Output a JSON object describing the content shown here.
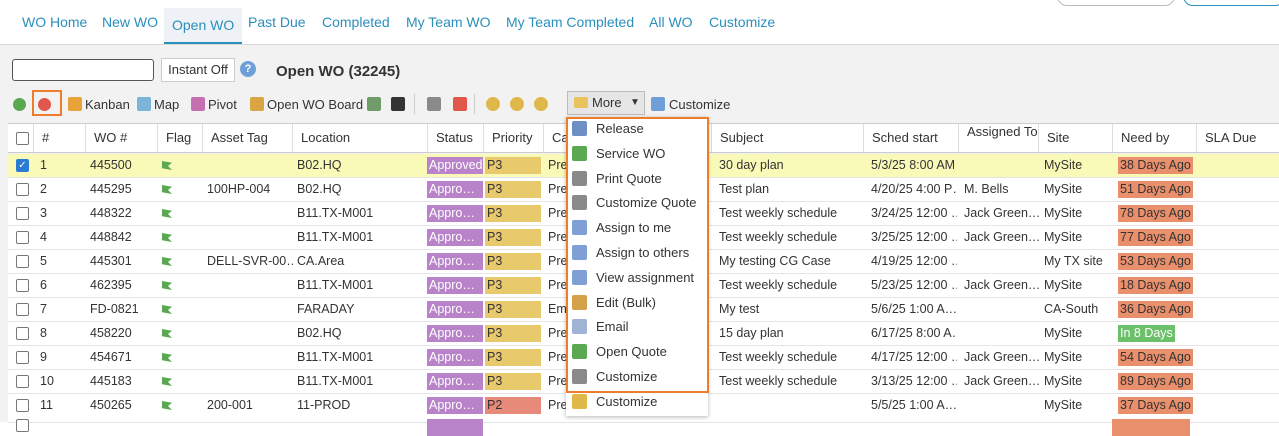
{
  "tabs": [
    {
      "label": "WO Home"
    },
    {
      "label": "New WO"
    },
    {
      "label": "Open WO"
    },
    {
      "label": "Past Due"
    },
    {
      "label": "Completed"
    },
    {
      "label": "My Team WO"
    },
    {
      "label": "My Team Completed"
    },
    {
      "label": "All WO"
    },
    {
      "label": "Customize"
    }
  ],
  "active_tab": "Open WO",
  "toolbar": {
    "search_value": "",
    "instant_label": "Instant Off",
    "page_title": "Open WO (32245)",
    "kanban": "Kanban",
    "map": "Map",
    "pivot": "Pivot",
    "open_board": "Open WO Board",
    "more": "More",
    "customize": "Customize"
  },
  "table": {
    "headers": [
      "#",
      "WO #",
      "Flag",
      "Asset Tag",
      "Location",
      "Status",
      "Priority",
      "Cat",
      "Subject",
      "Sched start",
      "Assigned To",
      "Site",
      "Need by",
      "SLA Due"
    ],
    "rows": [
      {
        "num": "1",
        "wo": "445500",
        "asset": "",
        "location": "B02.HQ",
        "status": "Approved",
        "priority": "P3",
        "cat": "Prev",
        "subject": "30 day plan",
        "sched": "5/3/25 8:00 AM (",
        "assigned": "",
        "site": "MySite",
        "need": "38 Days Ago",
        "need_color": "#ea8f6c",
        "checked": true,
        "selected": true
      },
      {
        "num": "2",
        "wo": "445295",
        "asset": "100HP-004",
        "location": "B02.HQ",
        "status": "Appro…",
        "priority": "P3",
        "cat": "Prev",
        "subject": "Test plan",
        "sched": "4/20/25 4:00 P…",
        "assigned": "M. Bells",
        "site": "MySite",
        "need": "51 Days Ago",
        "need_color": "#ea8f6c",
        "checked": false,
        "selected": false
      },
      {
        "num": "3",
        "wo": "448322",
        "asset": "",
        "location": "B11.TX-M001",
        "status": "Appro…",
        "priority": "P3",
        "cat": "Prev",
        "subject": "Test weekly schedule",
        "sched": "3/24/25 12:00 …",
        "assigned": "Jack Green…",
        "site": "MySite",
        "need": "78 Days Ago",
        "need_color": "#ea8f6c",
        "checked": false,
        "selected": false
      },
      {
        "num": "4",
        "wo": "448842",
        "asset": "",
        "location": "B11.TX-M001",
        "status": "Appro…",
        "priority": "P3",
        "cat": "Prev",
        "subject": "Test weekly schedule",
        "sched": "3/25/25 12:00 …",
        "assigned": "Jack Green…",
        "site": "MySite",
        "need": "77 Days Ago",
        "need_color": "#ea8f6c",
        "checked": false,
        "selected": false
      },
      {
        "num": "5",
        "wo": "445301",
        "asset": "DELL-SVR-00…",
        "location": "CA.Area",
        "status": "Appro…",
        "priority": "P3",
        "cat": "Prev",
        "subject": "My testing CG Case",
        "sched": "4/19/25 12:00 …",
        "assigned": "",
        "site": "My TX site",
        "need": "53 Days Ago",
        "need_color": "#ea8f6c",
        "checked": false,
        "selected": false
      },
      {
        "num": "6",
        "wo": "462395",
        "asset": "",
        "location": "B11.TX-M001",
        "status": "Appro…",
        "priority": "P3",
        "cat": "Prev",
        "subject": "Test weekly schedule",
        "sched": "5/23/25 12:00 …",
        "assigned": "Jack Green…",
        "site": "MySite",
        "need": "18 Days Ago",
        "need_color": "#ea8f6c",
        "checked": false,
        "selected": false
      },
      {
        "num": "7",
        "wo": "FD-0821",
        "asset": "",
        "location": "FARADAY",
        "status": "Appro…",
        "priority": "P3",
        "cat": "Em",
        "subject": "My test",
        "sched": "5/6/25 1:00 A…",
        "assigned": "",
        "site": "CA-South",
        "need": "36 Days Ago",
        "need_color": "#ea8f6c",
        "checked": false,
        "selected": false
      },
      {
        "num": "8",
        "wo": "458220",
        "asset": "",
        "location": "B02.HQ",
        "status": "Appro…",
        "priority": "P3",
        "cat": "Prev",
        "subject": "15 day plan",
        "sched": "6/17/25 8:00 A…",
        "assigned": "",
        "site": "MySite",
        "need": "In 8 Days",
        "need_color": "#6cc06a",
        "checked": false,
        "selected": false
      },
      {
        "num": "9",
        "wo": "454671",
        "asset": "",
        "location": "B11.TX-M001",
        "status": "Appro…",
        "priority": "P3",
        "cat": "Prev",
        "subject": "Test weekly schedule",
        "sched": "4/17/25 12:00 …",
        "assigned": "Jack Green…",
        "site": "MySite",
        "need": "54 Days Ago",
        "need_color": "#ea8f6c",
        "checked": false,
        "selected": false
      },
      {
        "num": "10",
        "wo": "445183",
        "asset": "",
        "location": "B11.TX-M001",
        "status": "Appro…",
        "priority": "P3",
        "cat": "Prev",
        "subject": "Test weekly schedule",
        "sched": "3/13/25 12:00 …",
        "assigned": "Jack Green…",
        "site": "MySite",
        "need": "89 Days Ago",
        "need_color": "#ea8f6c",
        "checked": false,
        "selected": false
      },
      {
        "num": "11",
        "wo": "450265",
        "asset": "200-001",
        "location": "11-PROD",
        "status": "Appro…",
        "priority": "P2",
        "cat": "Prev",
        "subject": "",
        "sched": "5/5/25 1:00 A…",
        "assigned": "",
        "site": "MySite",
        "need": "37 Days Ago",
        "need_color": "#ea8f6c",
        "checked": false,
        "selected": false
      }
    ]
  },
  "more_menu": [
    {
      "label": "Release",
      "icon": "release-icon",
      "color": "#6d8fc6"
    },
    {
      "label": "Service WO",
      "icon": "service-wo-icon",
      "color": "#5aa84f"
    },
    {
      "label": "Print Quote",
      "icon": "printer-icon",
      "color": "#8a8a8a"
    },
    {
      "label": "Customize Quote",
      "icon": "printer-icon",
      "color": "#8a8a8a"
    },
    {
      "label": "Assign to me",
      "icon": "document-icon",
      "color": "#7fa0d4"
    },
    {
      "label": "Assign to others",
      "icon": "document-icon",
      "color": "#7fa0d4"
    },
    {
      "label": "View assignment",
      "icon": "document-icon",
      "color": "#7fa0d4"
    },
    {
      "label": "Edit (Bulk)",
      "icon": "edit-icon",
      "color": "#d4a14a"
    },
    {
      "label": "Email",
      "icon": "envelope-icon",
      "color": "#9fb3d6"
    },
    {
      "label": "Open Quote",
      "icon": "open-quote-icon",
      "color": "#5aa84f"
    },
    {
      "label": "Customize",
      "icon": "printer-icon",
      "color": "#8a8a8a"
    },
    {
      "label": "Customize",
      "icon": "customize-icon",
      "color": "#e0b84a"
    }
  ],
  "colors": {
    "accent": "#2a8fbd",
    "highlight": "#ef7c2a",
    "status_approved": "#b883c9",
    "priority_p3": "#e8c96c",
    "priority_p2": "#e88a7a",
    "selected_row": "#fafab8"
  }
}
